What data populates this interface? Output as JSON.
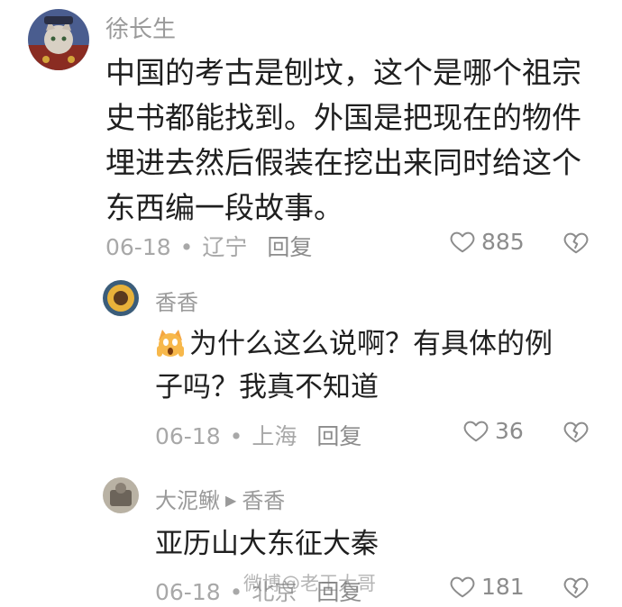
{
  "comments": [
    {
      "username": "徐长生",
      "lines": [
        "中国的考古是刨坟，这个是哪个祖宗",
        "史书都能找到。外国是把现在的物件",
        "埋进去然后假装在挖出来同时给这个",
        "东西编一段故事。"
      ],
      "date": "06-18",
      "location": "辽宁",
      "reply_label": "回复",
      "likes": "885"
    },
    {
      "username": "香香",
      "lines": [
        "为什么这么说啊？有具体的例",
        "子吗？我真不知道"
      ],
      "date": "06-18",
      "location": "上海",
      "reply_label": "回复",
      "likes": "36"
    },
    {
      "username": "大泥鳅",
      "reply_to": "香香",
      "lines": [
        "亚历山大东征大秦"
      ],
      "date": "06-18",
      "location": "北京",
      "reply_label": "回复",
      "likes": "181"
    }
  ],
  "watermark": "微博@老王大哥",
  "separator": "•",
  "colors": {
    "meta": "#a8a8a8",
    "username": "#9a9a9a",
    "text": "#1f1f1f"
  },
  "icons": {
    "like": "heart-outline-icon",
    "dislike": "broken-heart-icon",
    "reply_arrow": "play-arrow-icon"
  }
}
